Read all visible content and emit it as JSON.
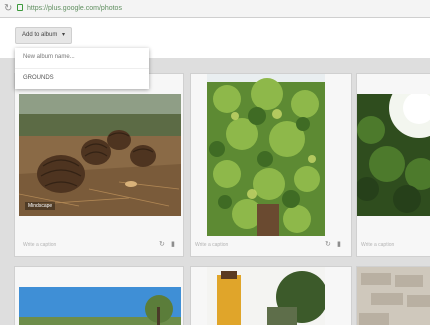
{
  "browser": {
    "reload_icon": "reload-icon",
    "lock_icon": "lock-icon",
    "url": "https://plus.google.com/photos"
  },
  "toolbar": {
    "add_to_album_label": "Add to album",
    "chevron_icon": "chevron-down-icon"
  },
  "dropdown": {
    "items": [
      {
        "label": "New album name..."
      },
      {
        "label": "GROUNDS"
      }
    ]
  },
  "photos": [
    {
      "subject": "pine cones on forest floor",
      "label": "Mindscape",
      "caption_placeholder": "Write a caption",
      "actions": [
        "rotate-icon",
        "trash-icon"
      ]
    },
    {
      "subject": "vertical green wall garden",
      "caption_placeholder": "Write a caption",
      "actions": [
        "rotate-icon",
        "trash-icon"
      ]
    },
    {
      "subject": "sunlit tree canopy",
      "caption_placeholder": "Write a caption"
    },
    {
      "subject": "blue sky with trees"
    },
    {
      "subject": "yellow tower with trees"
    },
    {
      "subject": "stone wall"
    }
  ]
}
